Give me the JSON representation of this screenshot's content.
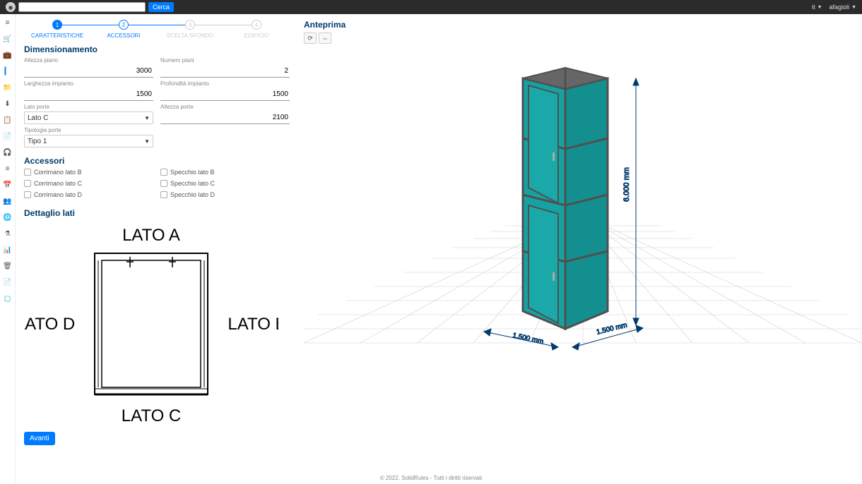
{
  "topbar": {
    "search_placeholder": "",
    "search_btn": "Cerca",
    "lang": "it",
    "user": "afagioli"
  },
  "stepper": [
    {
      "num": "1",
      "label": "CARATTERISTICHE",
      "state": "current"
    },
    {
      "num": "2",
      "label": "ACCESSORI",
      "state": "enabled"
    },
    {
      "num": "3",
      "label": "SCELTA SFONDO",
      "state": "disabled"
    },
    {
      "num": "4",
      "label": "EDIFICIO",
      "state": "disabled"
    }
  ],
  "dimensionamento": {
    "title": "Dimensionamento",
    "altezza_piano_label": "Altezza piano",
    "altezza_piano": "3000",
    "numero_piani_label": "Numero piani",
    "numero_piani": "2",
    "larghezza_label": "Larghezza impianto",
    "larghezza": "1500",
    "profondita_label": "Profondità impianto",
    "profondita": "1500",
    "lato_porte_label": "Lato porte",
    "lato_porte": "Lato C",
    "altezza_porte_label": "Altezza porte",
    "altezza_porte": "2100",
    "tipologia_label": "Tipologia porte",
    "tipologia": "Tipo 1"
  },
  "accessori": {
    "title": "Accessori",
    "items_left": [
      "Corrimano lato B",
      "Corrimano lato C",
      "Corrimano lato D"
    ],
    "items_right": [
      "Specchio lato B",
      "Specchio lato C",
      "Specchio lato D"
    ]
  },
  "dettaglio": {
    "title": "Dettaglio lati",
    "lato_a": "LATO A",
    "lato_b": "LATO B",
    "lato_c": "LATO C",
    "lato_d": "LATO D"
  },
  "avanti": "Avanti",
  "anteprima": {
    "title": "Anteprima",
    "dim_h": "6.000 mm",
    "dim_w1": "1.500 mm",
    "dim_w2": "1.500 mm"
  },
  "footer": "© 2022. SolidRules - Tutti i diritti riservati"
}
